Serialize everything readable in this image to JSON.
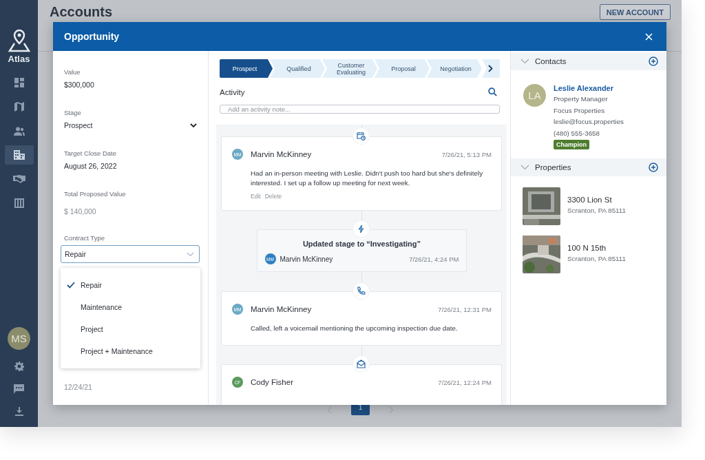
{
  "app": {
    "brand": "Atlas",
    "page_title": "Accounts",
    "new_account_button": "NEW ACCOUNT",
    "nav": [
      {
        "selected": false
      },
      {
        "selected": false
      },
      {
        "selected": false
      },
      {
        "selected": true
      },
      {
        "selected": false
      },
      {
        "selected": false
      }
    ],
    "user_initials": "MS",
    "pagination": [
      {
        "label": "1",
        "selected": true
      }
    ]
  },
  "modal": {
    "title": "Opportunity",
    "fields": [
      {
        "label": "Value",
        "value": "$300,000",
        "kind": "text"
      },
      {
        "label": "Stage",
        "value": "Prospect",
        "kind": "select"
      },
      {
        "label": "Target Close Date",
        "value": "August 26, 2022",
        "kind": "text"
      },
      {
        "label": "Total Proposed Value",
        "value": "$ 140,000",
        "kind": "readonly"
      }
    ],
    "contract_type": {
      "label": "Contract Type",
      "value": "Repair",
      "expanded": true,
      "options": [
        {
          "label": "Repair",
          "selected": true
        },
        {
          "label": "Maintenance",
          "selected": false
        },
        {
          "label": "Project",
          "selected": false
        },
        {
          "label": "Project + Maintenance",
          "selected": false
        }
      ]
    },
    "field_6": {
      "value": "12/24/21"
    },
    "stages": [
      {
        "label": "Prospect",
        "selected": true
      },
      {
        "label": "Qualified",
        "selected": false
      },
      {
        "label": "Customer Evaluating",
        "selected": false
      },
      {
        "label": "Proposal",
        "selected": false
      },
      {
        "label": "Negotiation",
        "selected": false
      }
    ],
    "activity": {
      "title": "Activity",
      "placeholder": "Add an activity note...",
      "items": [
        {
          "kind": "note",
          "initials": "MM",
          "color": "#6aa9c4",
          "name": "Marvin McKinney",
          "time": "7/26/21, 5:13 PM",
          "body": "Had an in-person meeting with Leslie. Didn't push too hard but she's definitely interested. I set up a follow up meeting for next week.",
          "actions": [
            "Edit",
            "Delete"
          ]
        },
        {
          "kind": "stage",
          "title": "Updated stage to “Investigating”",
          "initials": "MM",
          "color": "#2f7fc1",
          "name": "Marvin McKinney",
          "time": "7/26/21, 4:24 PM"
        },
        {
          "kind": "call",
          "initials": "MM",
          "color": "#6aa9c4",
          "name": "Marvin McKinney",
          "time": "7/26/21, 12:31 PM",
          "body": "Called, left a voicemail mentioning the upcoming inspection due date."
        },
        {
          "kind": "email",
          "initials": "CF",
          "color": "#5b9b5e",
          "name": "Cody Fisher",
          "time": "7/26/21, 12:24 PM"
        }
      ]
    },
    "contacts": {
      "title": "Contacts",
      "items": [
        {
          "initials": "LA",
          "name": "Leslie Alexander",
          "role": "Property Manager",
          "company": "Focus Properties",
          "email": "leslie@focus.properties",
          "phone": "(480) 555-3658",
          "tag": "Champion"
        }
      ]
    },
    "properties": {
      "title": "Properties",
      "items": [
        {
          "kind": "picture",
          "address": "3300 Lion St",
          "city": "Scranton, PA 85111"
        },
        {
          "kind": "picture",
          "address": "100 N 15th",
          "city": "Scranton, PA 85111"
        }
      ]
    }
  }
}
